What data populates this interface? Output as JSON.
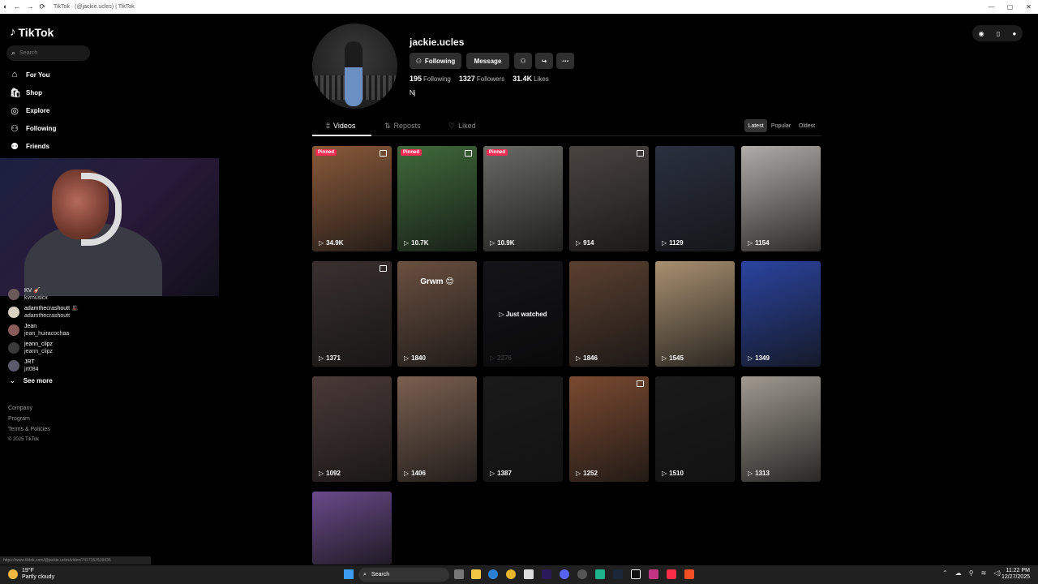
{
  "browser": {
    "tab_title": "TikTok · (@jackie.ucles) | TikTok",
    "window_buttons": [
      "—",
      "▢",
      "✕"
    ]
  },
  "sidebar": {
    "logo_text": "TikTok",
    "search_placeholder": "Search",
    "nav": [
      {
        "label": "For You",
        "icon": "home-icon"
      },
      {
        "label": "Shop",
        "icon": "shop-icon"
      },
      {
        "label": "Explore",
        "icon": "compass-icon"
      },
      {
        "label": "Following",
        "icon": "following-icon"
      },
      {
        "label": "Friends",
        "icon": "friends-icon"
      }
    ],
    "following_accounts": [
      {
        "name": "KV 🎸",
        "handle": "kvmusicx"
      },
      {
        "name": "adamthecrashoutt 🎩",
        "handle": "adamthecrashoutt"
      },
      {
        "name": "Jean",
        "handle": "jean_huiracochaa"
      },
      {
        "name": "jeann_clipz",
        "handle": "jeann_clipz"
      },
      {
        "name": "JRT",
        "handle": "jrt084"
      }
    ],
    "see_more": "See more",
    "footer": [
      "Company",
      "Program",
      "Terms & Policies"
    ],
    "copyright": "© 2025 TikTok"
  },
  "profile": {
    "username": "jackie.ucles",
    "following_button": "Following",
    "message_button": "Message",
    "following_count": "195",
    "following_label": "Following",
    "followers_count": "1327",
    "followers_label": "Followers",
    "likes_count": "31.4K",
    "likes_label": "Likes",
    "bio": "Nj"
  },
  "tabs": [
    "Videos",
    "Reposts",
    "Liked"
  ],
  "sort": [
    "Latest",
    "Popular",
    "Oldest"
  ],
  "videos": [
    {
      "views": "34.9K",
      "pinned": "Pinned",
      "photo": true,
      "color": "#8a5a3a"
    },
    {
      "views": "10.7K",
      "pinned": "Pinned",
      "photo": true,
      "color": "#3f6a3a"
    },
    {
      "views": "10.9K",
      "pinned": "Pinned",
      "photo": false,
      "color": "#6a6a66"
    },
    {
      "views": "914",
      "photo": true,
      "color": "#4a4440"
    },
    {
      "views": "1129",
      "photo": false,
      "color": "#2a3040"
    },
    {
      "views": "1154",
      "photo": false,
      "color": "#b0aca8"
    },
    {
      "views": "1371",
      "photo": true,
      "color": "#3a3030"
    },
    {
      "views": "1840",
      "caption": "Grwm 😊",
      "photo": false,
      "color": "#6a5040"
    },
    {
      "views": "2276",
      "watched": "Just watched",
      "photo": false,
      "color": "#303038"
    },
    {
      "views": "1846",
      "photo": false,
      "color": "#5a4030"
    },
    {
      "views": "1545",
      "photo": false,
      "color": "#a89070"
    },
    {
      "views": "1349",
      "photo": false,
      "color": "#2a44a0"
    },
    {
      "views": "1092",
      "photo": false,
      "color": "#4a3a38"
    },
    {
      "views": "1406",
      "photo": false,
      "color": "#7a6050"
    },
    {
      "views": "1387",
      "photo": false,
      "color": "#1a1a1a"
    },
    {
      "views": "1252",
      "photo": true,
      "color": "#7a4a30"
    },
    {
      "views": "1510",
      "photo": false,
      "color": "#1a1a1a"
    },
    {
      "views": "1313",
      "photo": false,
      "color": "#a09a90"
    },
    {
      "views": "",
      "photo": false,
      "color": "#6a4a8a"
    }
  ],
  "status_url": "https://www.tiktok.com/@jackie.ucles/video/7417152519435",
  "taskbar": {
    "temp": "19°F",
    "weather": "Partly cloudy",
    "search": "Search",
    "time": "11:22 PM",
    "date": "12/27/2025"
  }
}
